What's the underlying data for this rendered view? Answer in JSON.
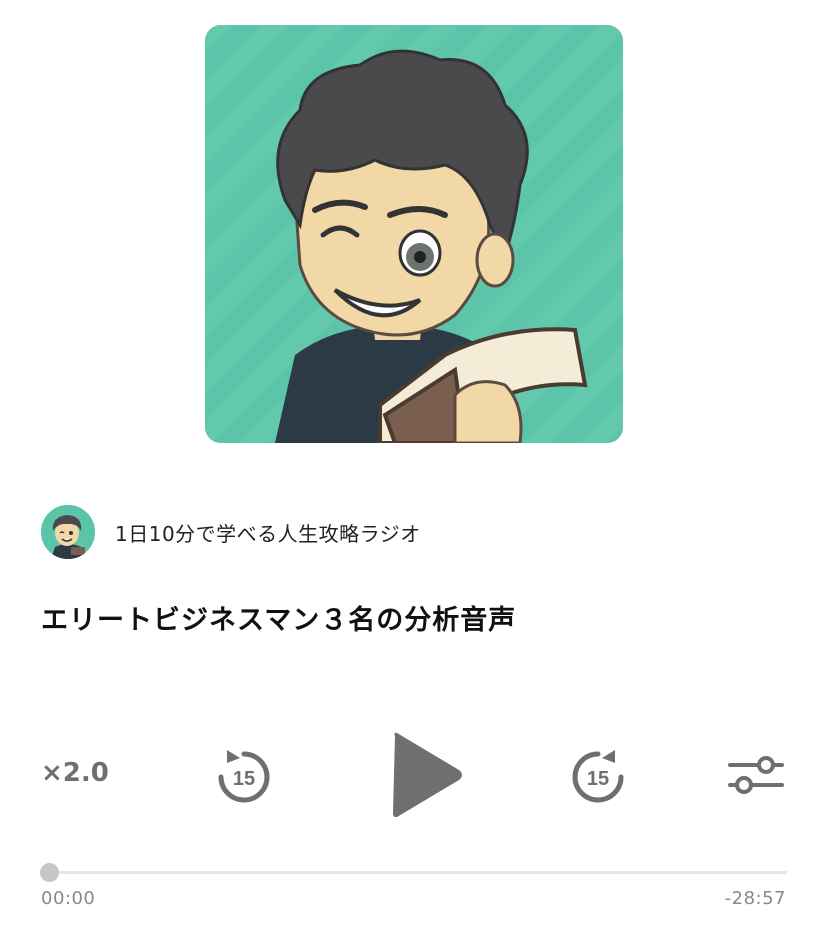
{
  "artwork": {
    "icon": "podcast-cover-art"
  },
  "channel": {
    "avatar_icon": "channel-avatar",
    "name": "1日10分で学べる人生攻略ラジオ"
  },
  "episode": {
    "title": "エリートビジネスマン３名の分析音声"
  },
  "controls": {
    "speed_label": "×2.0",
    "skip_back_seconds": "15",
    "skip_forward_seconds": "15",
    "play_icon": "play-icon",
    "settings_icon": "equalizer-sliders-icon"
  },
  "progress": {
    "fraction": 0.0,
    "elapsed": "00:00",
    "remaining": "-28:57"
  },
  "colors": {
    "artwork_bg": "#5cc4a8",
    "control_gray": "#6f6f6f",
    "track": "#e6e6e6"
  }
}
